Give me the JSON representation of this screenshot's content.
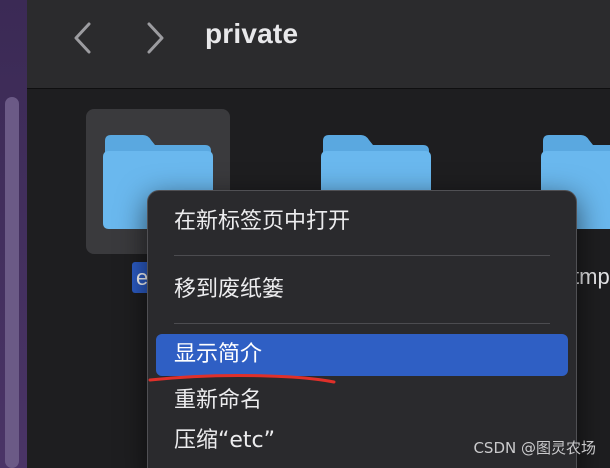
{
  "window": {
    "title": "private"
  },
  "toolbar": {
    "back_icon": "chevron-left-icon",
    "forward_icon": "chevron-right-icon"
  },
  "folders": [
    {
      "name": "etc",
      "visible_label": "e",
      "selected": true
    },
    {
      "name": "",
      "visible_label": "",
      "selected": false
    },
    {
      "name": "tmp",
      "visible_label": "tmp",
      "selected": false
    }
  ],
  "context_menu": {
    "items": [
      {
        "label": "在新标签页中打开"
      },
      {
        "label": "移到废纸篓"
      },
      {
        "label": "显示简介",
        "highlighted": true
      },
      {
        "label": "重新命名"
      },
      {
        "label": "压缩“etc”"
      }
    ]
  },
  "watermark": "CSDN @图灵农场",
  "colors": {
    "folder": "#6ab8ee",
    "folder_tab": "#5aa8e0",
    "highlight": "#2f5fc4",
    "annotation": "#e0302a",
    "sidebar": "#4a3466"
  }
}
